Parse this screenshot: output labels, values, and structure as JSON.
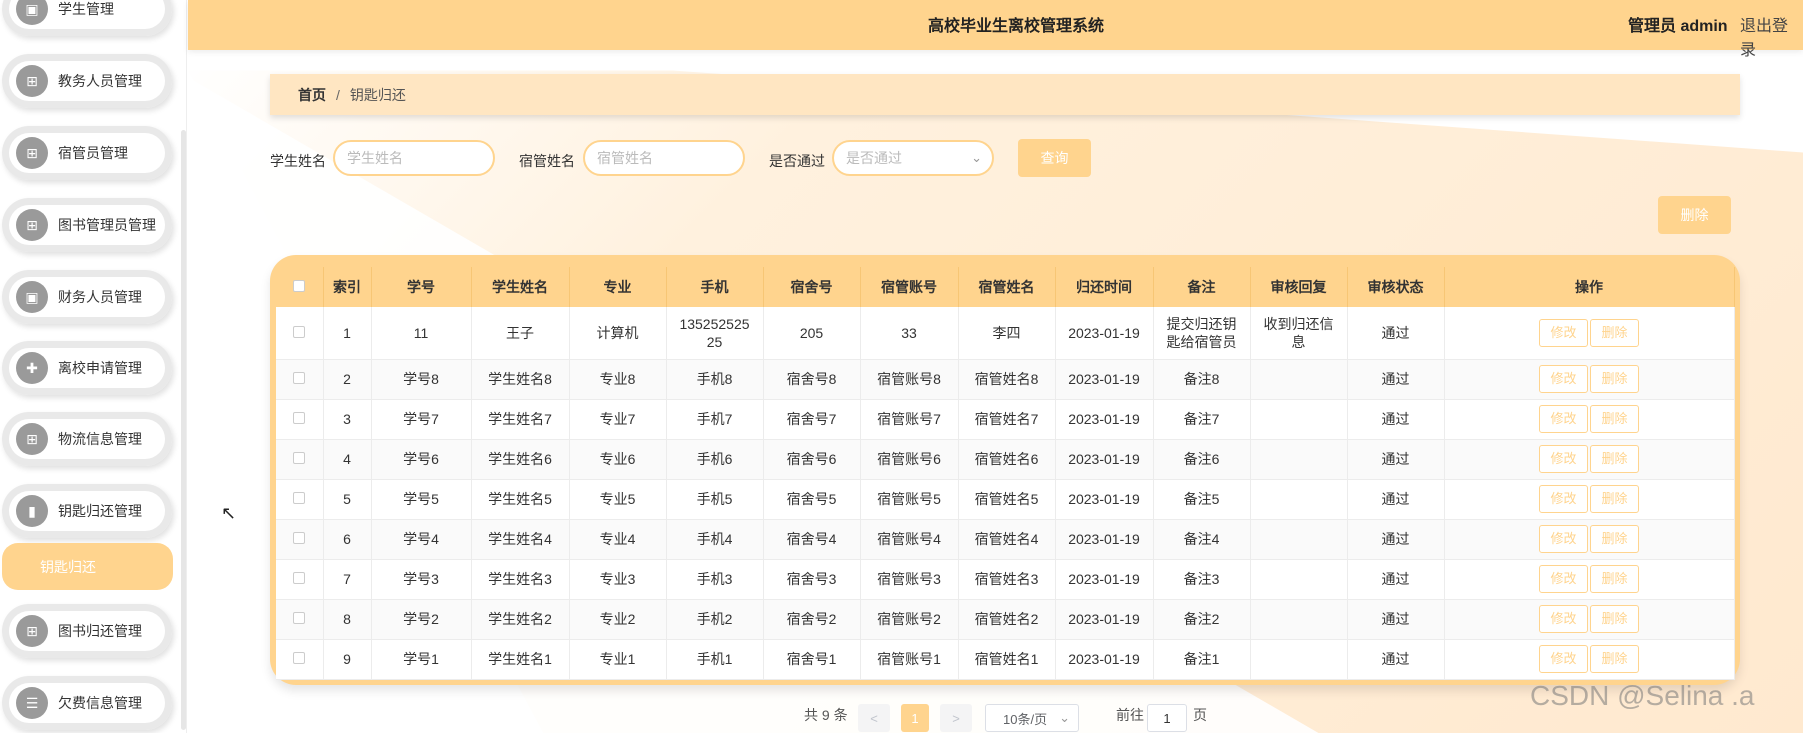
{
  "header": {
    "title": "高校毕业生离校管理系统",
    "user": "管理员 admin",
    "logout": "退出登录"
  },
  "sidebar": {
    "items": [
      {
        "label": "学生管理",
        "icon": "clipboard-icon",
        "glyph": "▣"
      },
      {
        "label": "教务人员管理",
        "icon": "grid-icon",
        "glyph": "⊞"
      },
      {
        "label": "宿管员管理",
        "icon": "grid-icon",
        "glyph": "⊞"
      },
      {
        "label": "图书管理员管理",
        "icon": "grid-icon",
        "glyph": "⊞"
      },
      {
        "label": "财务人员管理",
        "icon": "clipboard-icon",
        "glyph": "▣"
      },
      {
        "label": "离校申请管理",
        "icon": "puzzle-icon",
        "glyph": "✚"
      },
      {
        "label": "物流信息管理",
        "icon": "grid-icon",
        "glyph": "⊞"
      },
      {
        "label": "钥匙归还管理",
        "icon": "bar-chart-icon",
        "glyph": "▮"
      },
      {
        "label": "图书归还管理",
        "icon": "grid-icon",
        "glyph": "⊞"
      },
      {
        "label": "欠费信息管理",
        "icon": "list-icon",
        "glyph": "☰"
      }
    ],
    "submenu_active": "钥匙归还"
  },
  "breadcrumb": {
    "home": "首页",
    "separator": "/",
    "current": "钥匙归还"
  },
  "search": {
    "student_label": "学生姓名",
    "student_placeholder": "学生姓名",
    "dorm_label": "宿管姓名",
    "dorm_placeholder": "宿管姓名",
    "pass_label": "是否通过",
    "pass_placeholder": "是否通过",
    "query_button": "查询"
  },
  "delete_button": "删除",
  "table": {
    "columns": [
      "",
      "索引",
      "学号",
      "学生姓名",
      "专业",
      "手机",
      "宿舍号",
      "宿管账号",
      "宿管姓名",
      "归还时间",
      "备注",
      "审核回复",
      "审核状态",
      "操作"
    ],
    "edit_label": "修改",
    "delete_label": "删除",
    "rows": [
      [
        "1",
        "11",
        "王子",
        "计算机",
        "135252525\n25",
        "205",
        "33",
        "李四",
        "2023-01-19",
        "提交归还钥\n匙给宿管员",
        "收到归还信\n息",
        "通过"
      ],
      [
        "2",
        "学号8",
        "学生姓名8",
        "专业8",
        "手机8",
        "宿舍号8",
        "宿管账号8",
        "宿管姓名8",
        "2023-01-19",
        "备注8",
        "",
        "通过"
      ],
      [
        "3",
        "学号7",
        "学生姓名7",
        "专业7",
        "手机7",
        "宿舍号7",
        "宿管账号7",
        "宿管姓名7",
        "2023-01-19",
        "备注7",
        "",
        "通过"
      ],
      [
        "4",
        "学号6",
        "学生姓名6",
        "专业6",
        "手机6",
        "宿舍号6",
        "宿管账号6",
        "宿管姓名6",
        "2023-01-19",
        "备注6",
        "",
        "通过"
      ],
      [
        "5",
        "学号5",
        "学生姓名5",
        "专业5",
        "手机5",
        "宿舍号5",
        "宿管账号5",
        "宿管姓名5",
        "2023-01-19",
        "备注5",
        "",
        "通过"
      ],
      [
        "6",
        "学号4",
        "学生姓名4",
        "专业4",
        "手机4",
        "宿舍号4",
        "宿管账号4",
        "宿管姓名4",
        "2023-01-19",
        "备注4",
        "",
        "通过"
      ],
      [
        "7",
        "学号3",
        "学生姓名3",
        "专业3",
        "手机3",
        "宿舍号3",
        "宿管账号3",
        "宿管姓名3",
        "2023-01-19",
        "备注3",
        "",
        "通过"
      ],
      [
        "8",
        "学号2",
        "学生姓名2",
        "专业2",
        "手机2",
        "宿舍号2",
        "宿管账号2",
        "宿管姓名2",
        "2023-01-19",
        "备注2",
        "",
        "通过"
      ],
      [
        "9",
        "学号1",
        "学生姓名1",
        "专业1",
        "手机1",
        "宿舍号1",
        "宿管账号1",
        "宿管姓名1",
        "2023-01-19",
        "备注1",
        "",
        "通过"
      ]
    ]
  },
  "pagination": {
    "total": "共 9 条",
    "prev": "<",
    "current_page": "1",
    "next": ">",
    "page_size": "10条/页",
    "goto_label": "前往",
    "goto_value": "1",
    "page_suffix": "页"
  },
  "watermark": "CSDN @Selina .a",
  "colors": {
    "accent": "#ffd48e",
    "breadcrumb_bg": "#ffe6c2"
  }
}
